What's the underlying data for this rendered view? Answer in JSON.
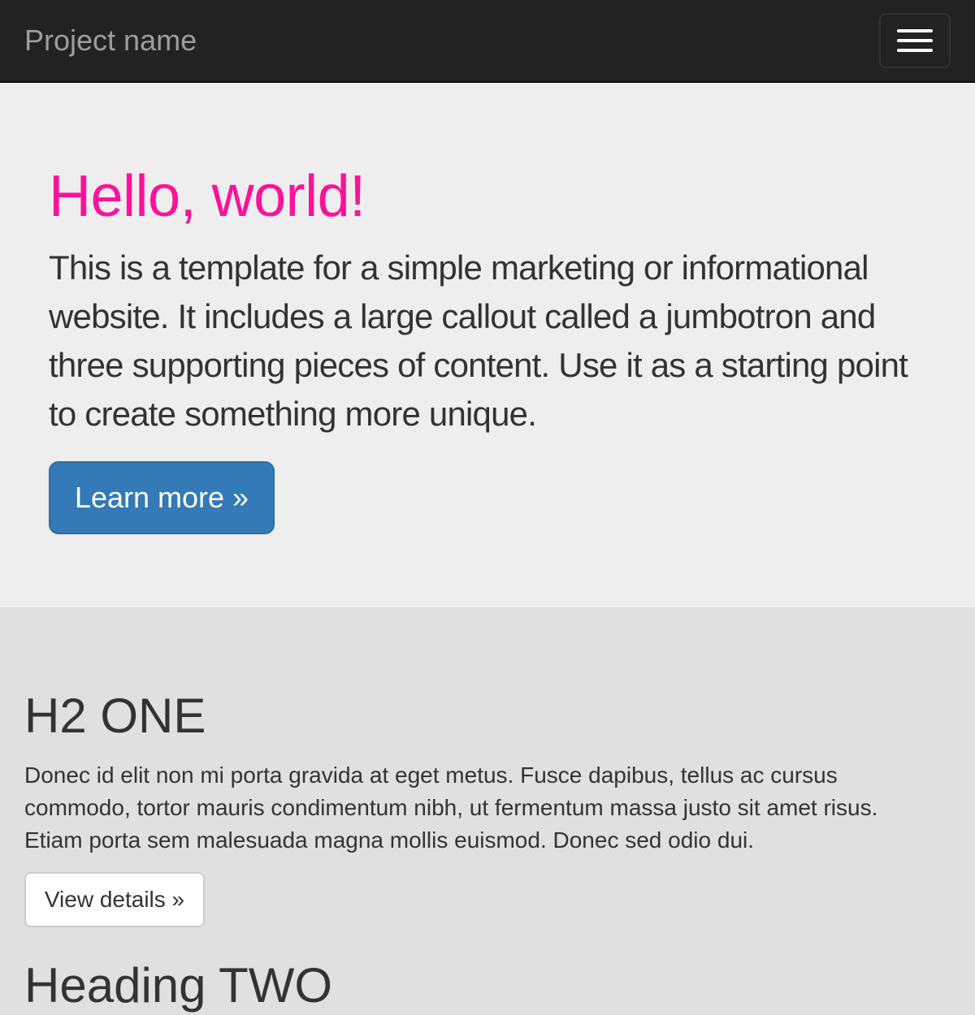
{
  "navbar": {
    "brand": "Project name",
    "toggle_icon": "hamburger-menu-icon",
    "background": "#222222",
    "brand_color": "#9d9d9d"
  },
  "jumbotron": {
    "title": "Hello, world!",
    "title_color": "#ff1199",
    "text": "This is a template for a simple marketing or informational website. It includes a large callout called a jumbotron and three supporting pieces of content. Use it as a starting point to create something more unique.",
    "button_label": "Learn more »",
    "button_color": "#337ab7",
    "background": "#eeeeee"
  },
  "sections": [
    {
      "title": "H2 ONE",
      "text": "Donec id elit non mi porta gravida at eget metus. Fusce dapibus, tellus ac cursus commodo, tortor mauris condimentum nibh, ut fermentum massa justo sit amet risus. Etiam porta sem malesuada magna mollis euismod. Donec sed odio dui.",
      "button_label": "View details »"
    },
    {
      "title": "Heading TWO"
    }
  ],
  "page_background": "#e0e0e0"
}
